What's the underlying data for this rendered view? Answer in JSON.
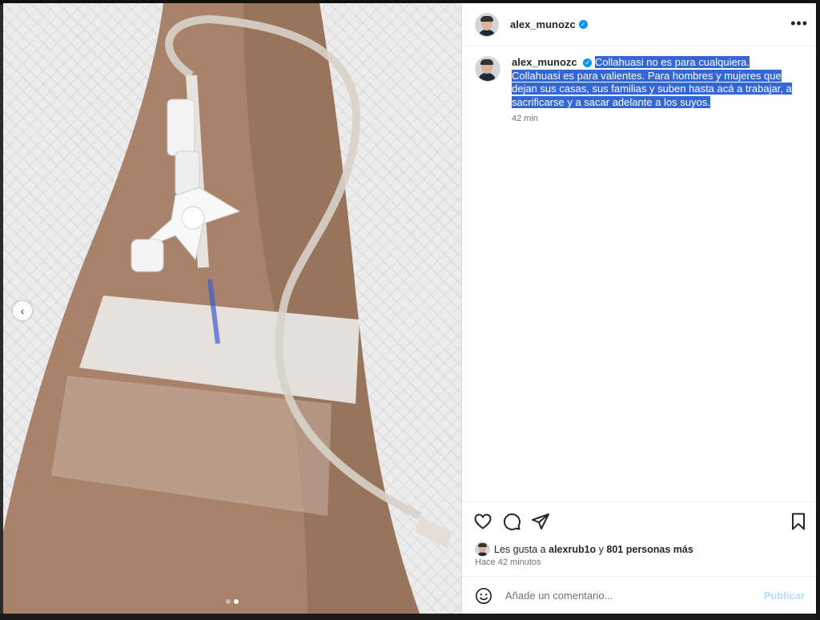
{
  "post": {
    "username": "alex_munozc",
    "caption": "Collahuasi no es para cualquiera. Collahuasi es para valientes. Para hombres y mujeres que dejan sus casas, sus familias y suben hasta acá a trabajar, a sacrificarse y a sacar adelante a los suyos.",
    "caption_time": "42 min",
    "likes_prefix": "Les gusta a",
    "likes_user": "alexrub1o",
    "likes_connector": "y",
    "likes_others": "801 personas más",
    "posted_ago": "Hace 42 minutos"
  },
  "comment": {
    "placeholder": "Añade un comentario...",
    "publish_label": "Publicar"
  },
  "media": {
    "carousel_total": 2,
    "carousel_current": 2
  },
  "icons": {
    "header_more": "more-options-icon",
    "prev": "chevron-left-icon",
    "like": "heart-icon",
    "comment": "comment-icon",
    "share": "share-icon",
    "save": "bookmark-icon",
    "emoji": "emoji-icon"
  },
  "colors": {
    "accent": "#0095f6",
    "selection": "#3367d6",
    "publish_disabled": "#b2dffc"
  }
}
